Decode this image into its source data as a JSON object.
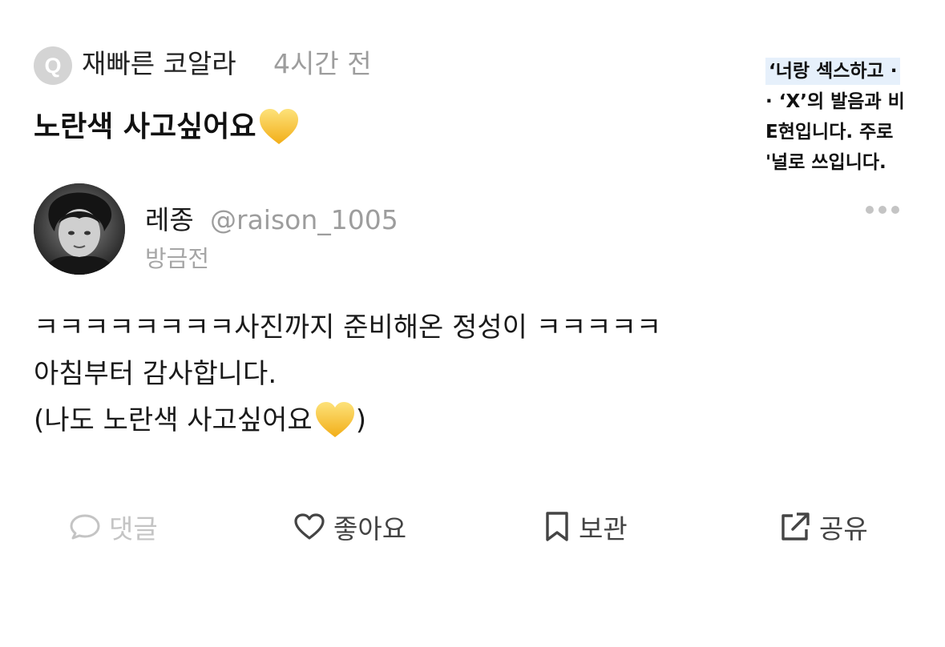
{
  "question": {
    "badge": "Q",
    "author": "재빠른 코알라",
    "time": "4시간 전",
    "title": "노란색 사고싶어요"
  },
  "thumbnail": {
    "lines": [
      "‘너랑 섹스하고 ·",
      "· ‘X’의 발음과 비",
      "E현입니다. 주로",
      "'널로 쓰입니다."
    ]
  },
  "reply": {
    "name": "레종",
    "handle": "@raison_1005",
    "time": "방금전",
    "lines": [
      "ㅋㅋㅋㅋㅋㅋㅋㅋ사진까지 준비해온 정성이 ㅋㅋㅋㅋㅋ",
      "아침부터 감사합니다.",
      "(나도 노란색 사고싶어요",
      ")"
    ]
  },
  "actions": {
    "comment": "댓글",
    "like": "좋아요",
    "save": "보관",
    "share": "공유"
  },
  "colors": {
    "heart_emoji": "#f9c531",
    "muted_text": "#9d9d9d",
    "thumbnail_highlight": "#e6f0fb"
  },
  "icons": [
    "q-badge-icon",
    "yellow-heart-icon",
    "more-icon",
    "comment-icon",
    "heart-outline-icon",
    "bookmark-icon",
    "share-icon"
  ]
}
